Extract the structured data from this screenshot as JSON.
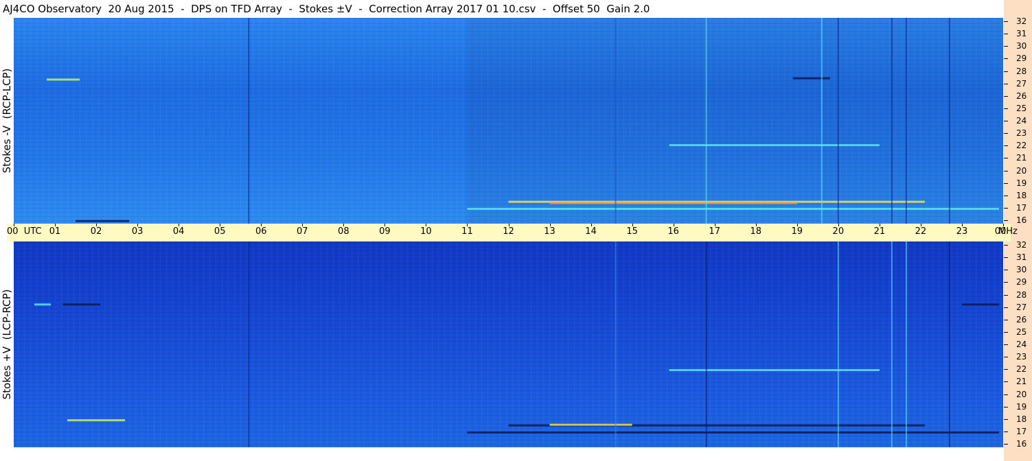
{
  "title": "AJ4CO Observatory  20 Aug 2015  -  DPS on TFD Array  -  Stokes ±V  -  Correction Array 2017 01 10.csv  -  Offset 50  Gain 2.0",
  "colors": {
    "background": "#ffffff",
    "axis_band": "#fff9c2",
    "right_band": "#fde0c4",
    "top_panel_base": "#1f74e8",
    "bottom_panel_base": "#1446d6",
    "event_yellow": "#f4e04a",
    "event_cyan": "#5fe3f0",
    "event_dark": "#0a1a55"
  },
  "chart_data": [
    {
      "type": "heatmap",
      "ylabel": "Stokes -V  (RCP-LCP)",
      "xlim": [
        0,
        24
      ],
      "ylim": [
        16,
        32
      ],
      "y_ticks": [
        "32",
        "31",
        "30",
        "29",
        "28",
        "27",
        "26",
        "25",
        "24",
        "23",
        "22",
        "21",
        "20",
        "19",
        "18",
        "17",
        "16"
      ],
      "features": [
        {
          "kind": "band",
          "t_start": 12.0,
          "t_end": 22.1,
          "f": 17.7,
          "color": "#f4e04a"
        },
        {
          "kind": "band",
          "t_start": 13.0,
          "t_end": 19.0,
          "f": 17.6,
          "color": "#ff9a3c"
        },
        {
          "kind": "band",
          "t_start": 11.0,
          "t_end": 23.9,
          "f": 17.15,
          "color": "#5fe3f0"
        },
        {
          "kind": "band",
          "t_start": 18.9,
          "t_end": 19.8,
          "f": 27.3,
          "color": "#0a1a55"
        },
        {
          "kind": "band",
          "t_start": 0.8,
          "t_end": 1.6,
          "f": 27.2,
          "color": "#c8f05a"
        },
        {
          "kind": "band",
          "t_start": 1.5,
          "t_end": 2.8,
          "f": 16.2,
          "color": "#0a1a55"
        },
        {
          "kind": "band",
          "t_start": 15.9,
          "t_end": 21.0,
          "f": 22.1,
          "color": "#5fe3f0"
        },
        {
          "kind": "vline",
          "t": 5.7,
          "color": "#0a2a8a"
        },
        {
          "kind": "vline",
          "t": 16.8,
          "color": "#5fe3f0"
        },
        {
          "kind": "vline",
          "t": 20.0,
          "color": "#0a2a8a"
        },
        {
          "kind": "vline",
          "t": 21.3,
          "color": "#0a2a8a"
        },
        {
          "kind": "vline",
          "t": 21.65,
          "color": "#0a2a8a"
        },
        {
          "kind": "vline",
          "t": 22.7,
          "color": "#0a2a8a"
        },
        {
          "kind": "vline",
          "t": 14.6,
          "color": "#1a55c8"
        },
        {
          "kind": "vline",
          "t": 19.6,
          "color": "#5fe3f0"
        }
      ]
    },
    {
      "type": "heatmap",
      "ylabel": "Stokes +V  (LCP-RCP)",
      "xlim": [
        0,
        24
      ],
      "ylim": [
        16,
        32
      ],
      "y_ticks": [
        "32",
        "31",
        "30",
        "29",
        "28",
        "27",
        "26",
        "25",
        "24",
        "23",
        "22",
        "21",
        "20",
        "19",
        "18",
        "17",
        "16"
      ],
      "features": [
        {
          "kind": "band",
          "t_start": 12.0,
          "t_end": 22.1,
          "f": 17.7,
          "color": "#0a1a55"
        },
        {
          "kind": "band",
          "t_start": 13.0,
          "t_end": 15.0,
          "f": 17.75,
          "color": "#f4e04a"
        },
        {
          "kind": "band",
          "t_start": 11.0,
          "t_end": 23.9,
          "f": 17.15,
          "color": "#0a1a55"
        },
        {
          "kind": "band",
          "t_start": 1.2,
          "t_end": 2.1,
          "f": 27.1,
          "color": "#0a1a55"
        },
        {
          "kind": "band",
          "t_start": 0.5,
          "t_end": 0.9,
          "f": 27.1,
          "color": "#5fe3f0"
        },
        {
          "kind": "band",
          "t_start": 1.3,
          "t_end": 2.7,
          "f": 18.1,
          "color": "#c8f05a"
        },
        {
          "kind": "band",
          "t_start": 15.9,
          "t_end": 21.0,
          "f": 22.0,
          "color": "#5fe3f0"
        },
        {
          "kind": "band",
          "t_start": 23.0,
          "t_end": 23.9,
          "f": 27.1,
          "color": "#0a1a55"
        },
        {
          "kind": "vline",
          "t": 5.7,
          "color": "#0a2a8a"
        },
        {
          "kind": "vline",
          "t": 16.8,
          "color": "#0a1a70"
        },
        {
          "kind": "vline",
          "t": 20.0,
          "color": "#5fe3f0"
        },
        {
          "kind": "vline",
          "t": 21.3,
          "color": "#5fe3f0"
        },
        {
          "kind": "vline",
          "t": 21.65,
          "color": "#5fe3f0"
        },
        {
          "kind": "vline",
          "t": 22.7,
          "color": "#0a1a70"
        },
        {
          "kind": "vline",
          "t": 14.6,
          "color": "#3b8cf0"
        }
      ]
    }
  ],
  "x_axis": {
    "ticks": [
      {
        "t": 0,
        "label": "00  UTC"
      },
      {
        "t": 1,
        "label": "01"
      },
      {
        "t": 2,
        "label": "02"
      },
      {
        "t": 3,
        "label": "03"
      },
      {
        "t": 4,
        "label": "04"
      },
      {
        "t": 5,
        "label": "05"
      },
      {
        "t": 6,
        "label": "06"
      },
      {
        "t": 7,
        "label": "07"
      },
      {
        "t": 8,
        "label": "08"
      },
      {
        "t": 9,
        "label": "09"
      },
      {
        "t": 10,
        "label": "10"
      },
      {
        "t": 11,
        "label": "11"
      },
      {
        "t": 12,
        "label": "12"
      },
      {
        "t": 13,
        "label": "13"
      },
      {
        "t": 14,
        "label": "14"
      },
      {
        "t": 15,
        "label": "15"
      },
      {
        "t": 16,
        "label": "16"
      },
      {
        "t": 17,
        "label": "17"
      },
      {
        "t": 18,
        "label": "18"
      },
      {
        "t": 19,
        "label": "19"
      },
      {
        "t": 20,
        "label": "20"
      },
      {
        "t": 21,
        "label": "21"
      },
      {
        "t": 22,
        "label": "22"
      },
      {
        "t": 23,
        "label": "23"
      },
      {
        "t": 24,
        "label": "00"
      }
    ],
    "unit": "MHz"
  }
}
